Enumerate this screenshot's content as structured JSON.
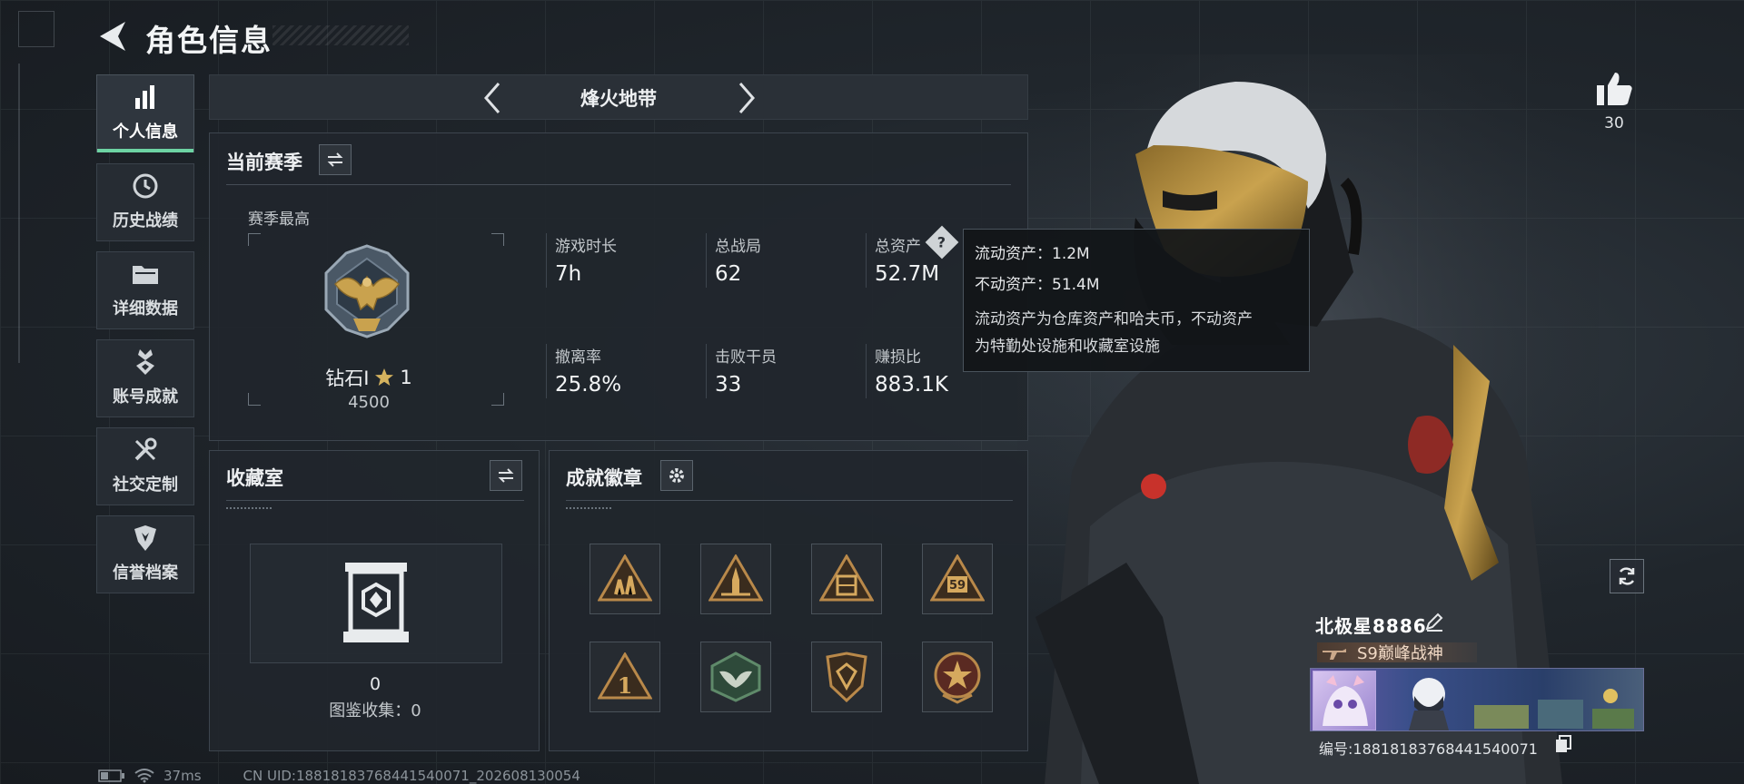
{
  "header": {
    "title": "角色信息"
  },
  "sidebar": {
    "items": [
      {
        "label": "个人信息",
        "icon": "bar-chart-icon",
        "active": true
      },
      {
        "label": "历史战绩",
        "icon": "clock-icon"
      },
      {
        "label": "详细数据",
        "icon": "folder-icon"
      },
      {
        "label": "账号成就",
        "icon": "medal-icon"
      },
      {
        "label": "社交定制",
        "icon": "tools-icon"
      },
      {
        "label": "信誉档案",
        "icon": "shield-icon"
      }
    ]
  },
  "mode": {
    "name": "烽火地带"
  },
  "season": {
    "title": "当前赛季",
    "best_label": "赛季最高",
    "rank": {
      "name": "钻石I",
      "stars": "1",
      "points": "4500"
    },
    "stats": [
      {
        "label": "游戏时长",
        "value": "7h"
      },
      {
        "label": "总战局",
        "value": "62"
      },
      {
        "label": "总资产",
        "value": "52.7M"
      },
      {
        "label": "撤离率",
        "value": "25.8%"
      },
      {
        "label": "击败干员",
        "value": "33"
      },
      {
        "label": "赚损比",
        "value": "883.1K"
      }
    ],
    "help_glyph": "?"
  },
  "tooltip": {
    "liquid": "流动资产：1.2M",
    "fixed": "不动资产：51.4M",
    "desc_line1": "流动资产为仓库资产和哈夫币，不动资产",
    "desc_line2": "为特勤处设施和收藏室设施"
  },
  "collection": {
    "title": "收藏室",
    "count": "0",
    "catalog": "图鉴收集：0"
  },
  "achievements": {
    "title": "成就徽章",
    "badges": [
      {
        "icon": "soldiers-triangle-badge-icon",
        "color": "#b9894a"
      },
      {
        "icon": "rocket-triangle-badge-icon",
        "color": "#b9894a"
      },
      {
        "icon": "crate-triangle-badge-icon",
        "color": "#b9894a"
      },
      {
        "icon": "number-59-triangle-badge-icon",
        "badge_text": "59",
        "color": "#b9894a"
      },
      {
        "icon": "number-1-triangle-badge-icon",
        "badge_text": "1",
        "color": "#b9894a"
      },
      {
        "icon": "wings-hexagon-badge-icon",
        "color": "#5f8a6a"
      },
      {
        "icon": "gem-shield-badge-icon",
        "color": "#b9894a"
      },
      {
        "icon": "star-roundel-badge-icon",
        "color": "#b9894a"
      }
    ]
  },
  "player": {
    "name": "北极星8886",
    "title": "S9巅峰战神",
    "id_text": "编号:18818183768441540071",
    "likes": "30"
  },
  "status": {
    "ping": "37ms",
    "uid": "CN UID:18818183768441540071_202608130054"
  }
}
